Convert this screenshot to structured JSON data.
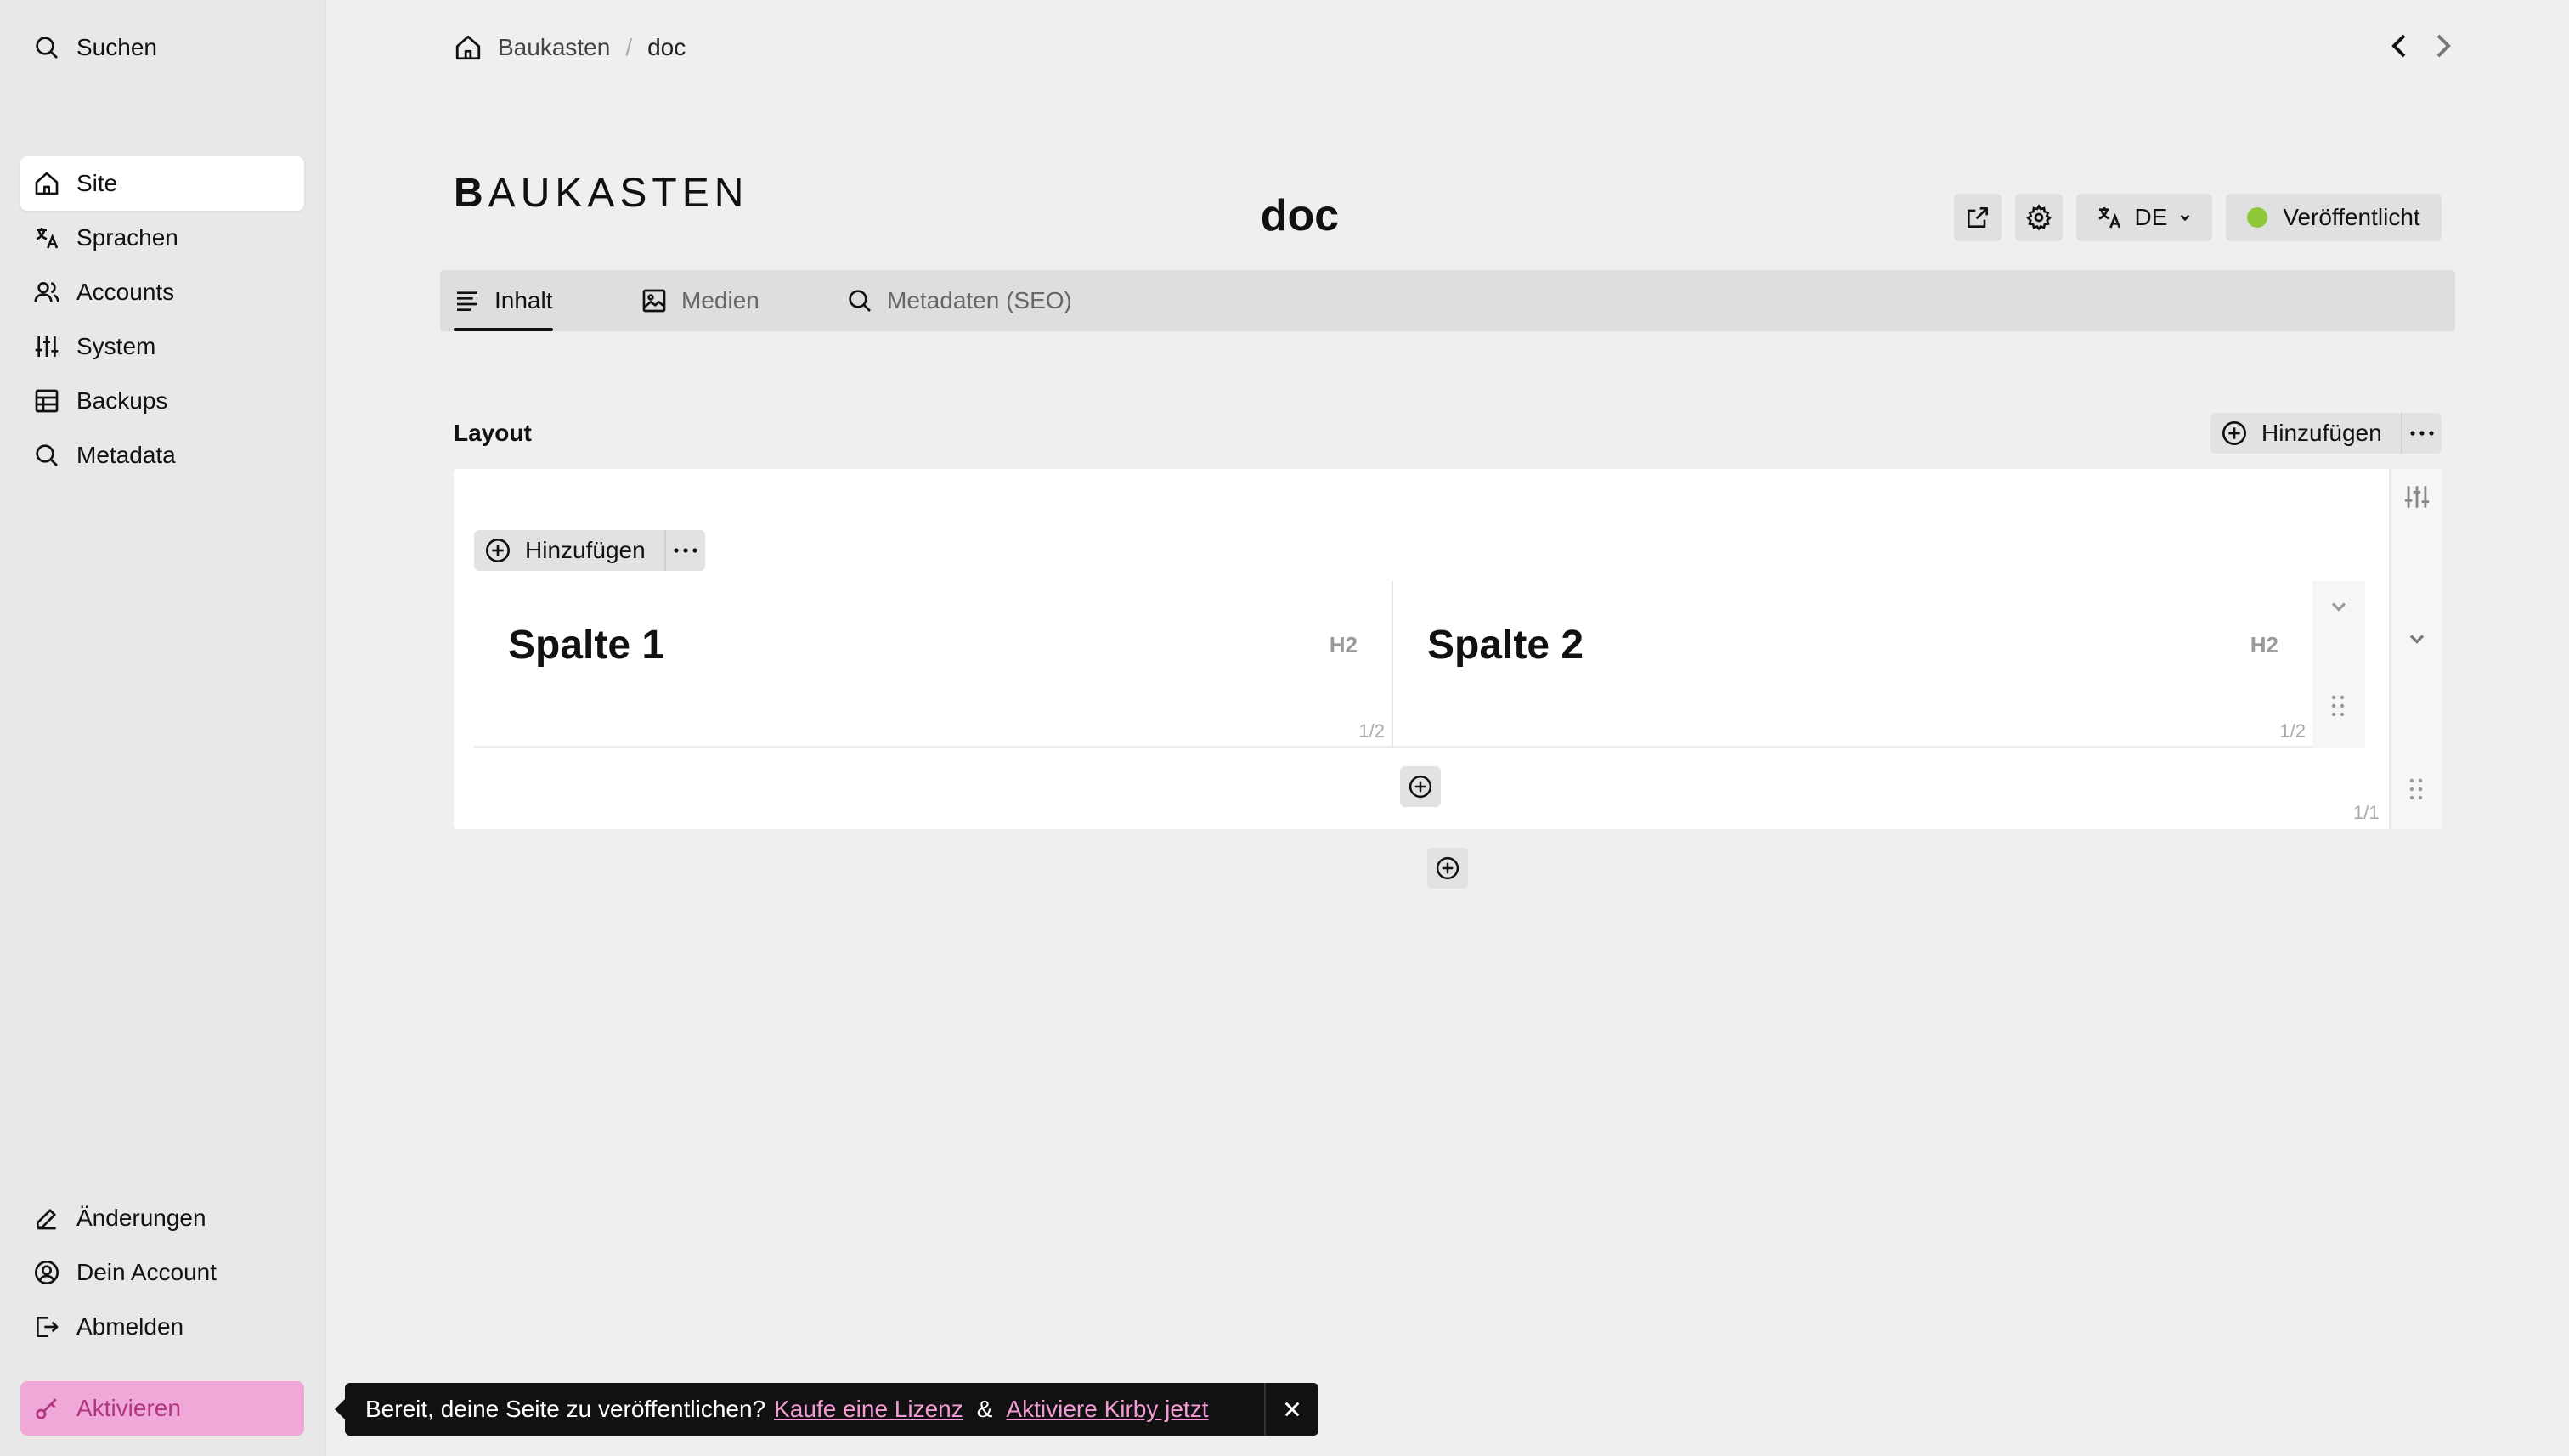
{
  "sidebar": {
    "search_label": "Suchen",
    "items": [
      {
        "label": "Site",
        "icon": "home-icon"
      },
      {
        "label": "Sprachen",
        "icon": "translate-icon"
      },
      {
        "label": "Accounts",
        "icon": "users-icon"
      },
      {
        "label": "System",
        "icon": "settings-sliders-icon"
      },
      {
        "label": "Backups",
        "icon": "table-icon"
      },
      {
        "label": "Metadata",
        "icon": "search-icon"
      }
    ],
    "bottom": [
      {
        "label": "Änderungen",
        "icon": "pencil-icon"
      },
      {
        "label": "Dein Account",
        "icon": "account-icon"
      },
      {
        "label": "Abmelden",
        "icon": "logout-icon"
      }
    ],
    "activate_label": "Aktivieren"
  },
  "breadcrumb": {
    "home": "Baukasten",
    "separator": "/",
    "current": "doc"
  },
  "header": {
    "brand": "BAUKASTEN",
    "title": "doc",
    "language": "DE",
    "status_label": "Veröffentlicht",
    "status_color": "#8fc93a"
  },
  "tabs": [
    {
      "label": "Inhalt",
      "icon": "text-lines-icon",
      "active": true
    },
    {
      "label": "Medien",
      "icon": "image-icon",
      "active": false
    },
    {
      "label": "Metadaten (SEO)",
      "icon": "search-icon",
      "active": false
    }
  ],
  "layout": {
    "label": "Layout",
    "add_label": "Hinzufügen",
    "inner_add_label": "Hinzufügen",
    "columns": [
      {
        "heading": "Spalte 1",
        "tag": "H2",
        "width": "1/2"
      },
      {
        "heading": "Spalte 2",
        "tag": "H2",
        "width": "1/2"
      }
    ],
    "layout_width": "1/1"
  },
  "banner": {
    "text": "Bereit, deine Seite zu veröffentlichen?",
    "link1": "Kaufe eine Lizenz",
    "amp": "&",
    "link2": "Aktiviere Kirby jetzt"
  },
  "colors": {
    "accent_pink": "#f0a8d8",
    "link_pink": "#f39bd5",
    "status_green": "#8fc93a"
  }
}
